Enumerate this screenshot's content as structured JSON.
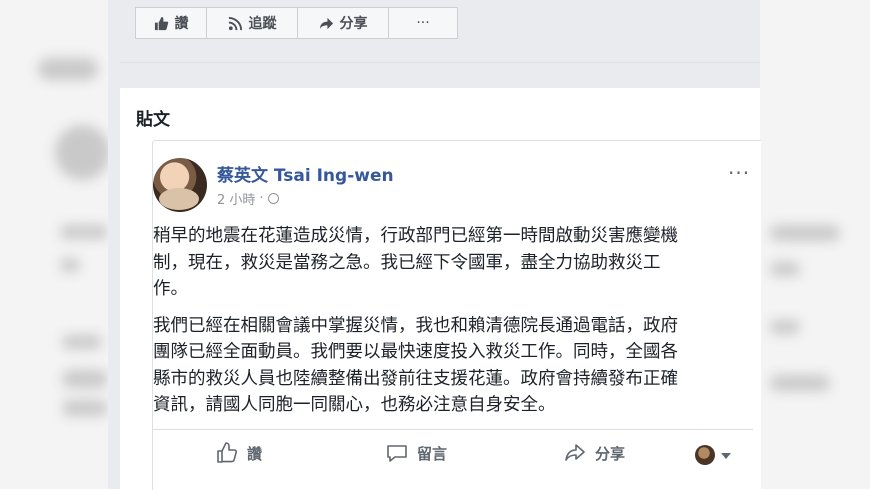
{
  "top_actions": {
    "like_label": "讚",
    "follow_label": "追蹤",
    "share_label": "分享",
    "more_label": "···"
  },
  "section": {
    "title": "貼文"
  },
  "post": {
    "author": "蔡英文 Tsai Ing-wen",
    "timestamp": "2 小時",
    "paragraphs": [
      "稍早的地震在花蓮造成災情，行政部門已經第一時間啟動災害應變機\n制，現在，救災是當務之急。我已經下令國軍，盡全力協助救災工\n作。",
      "我們已經在相關會議中掌握災情，我也和賴清德院長通過電話，政府\n團隊已經全面動員。我們要以最快速度投入救災工作。同時，全國各\n縣市的救災人員也陸續整備出發前往支援花蓮。政府會持續發布正確\n資訊，請國人同胞一同關心，也務必注意自身安全。"
    ],
    "footer": {
      "like": "讚",
      "comment": "留言",
      "share": "分享"
    }
  },
  "icons": [
    "thumbs-up-icon",
    "rss-icon",
    "share-arrow-icon",
    "globe-icon",
    "comment-icon"
  ]
}
